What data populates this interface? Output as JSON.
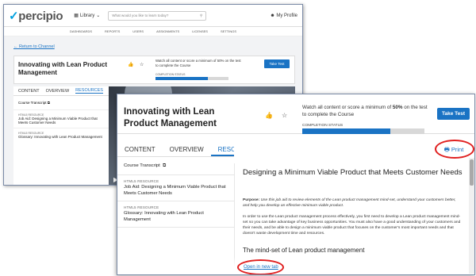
{
  "back_window": {
    "logo": "percipio",
    "library_label": "Library",
    "search_placeholder": "What would you like to learn today?",
    "profile_label": "My Profile",
    "nav": [
      "DASHBOARDS",
      "REPORTS",
      "USERS",
      "ASSIGNMENTS",
      "LICENSES",
      "SETTINGS"
    ],
    "return_link": "Return to Channel",
    "course_title": "Innovating with Lean Product Management",
    "watch_text": "Watch all content or score a minimum of 50% on the test to complete the Course",
    "take_test": "Take Test",
    "completion_label": "COMPLETION STATUS",
    "completion_fraction": 0.72,
    "tabs": [
      "CONTENT",
      "OVERVIEW",
      "RESOURCES"
    ],
    "resources": {
      "transcript": "Course Transcript",
      "items": [
        {
          "kind": "HTML5 RESOURCE",
          "title": "Job Aid: Designing a Minimum Viable Product that Meets Customer Needs"
        },
        {
          "kind": "HTML5 RESOURCE",
          "title": "Glossary: Innovating with Lean Product Management"
        }
      ]
    }
  },
  "front_window": {
    "course_title": "Innovating with Lean Product Management",
    "watch_text_pre": "Watch all content or score a minimum of ",
    "watch_bold": "50%",
    "watch_text_post": " on the test to complete the Course",
    "take_test": "Take Test",
    "completion_label": "COMPLETION STATUS",
    "completion_fraction": 0.72,
    "tabs": [
      "CONTENT",
      "OVERVIEW",
      "RESOURCES"
    ],
    "active_tab": "RESOURCES",
    "resources": {
      "transcript": "Course Transcript",
      "items": [
        {
          "kind": "HTML5 RESOURCE",
          "title": "Job Aid: Designing a Minimum Viable Product that Meets Customer Needs"
        },
        {
          "kind": "HTML5 RESOURCE",
          "title": "Glossary: Innovating with Lean Product Management"
        }
      ]
    },
    "print_label": "Print",
    "doc": {
      "title": "Designing a Minimum Viable Product that Meets Customer Needs",
      "purpose_label": "Purpose:",
      "purpose_text": "Use this job aid to review elements of the Lean product management mind-set, understand your customers better, and help you develop an effective minimum viable product.",
      "body": "In order to use the Lean product management process effectively, you first need to develop a Lean product management mind-set so you can take advantage of key business opportunities. You must also have a good understanding of your customers and their needs, and be able to design a minimum viable product that focuses on the customer's most important needs and that doesn't waste development time and resources.",
      "subheading": "The mind-set of Lean product management"
    },
    "open_new_tab": "Open in new tab"
  },
  "colors": {
    "accent": "#1a73c4",
    "highlight_ring": "#e02020"
  }
}
